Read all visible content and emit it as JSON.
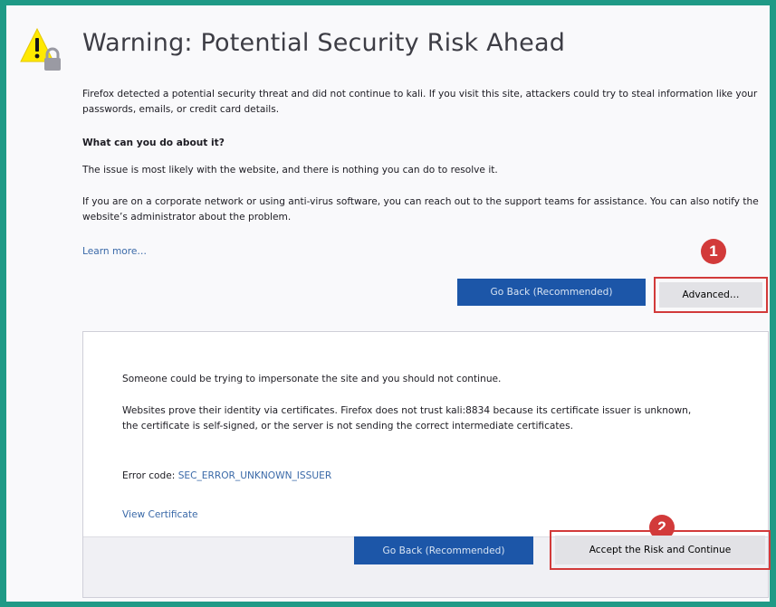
{
  "header": {
    "title": "Warning: Potential Security Risk Ahead",
    "icon": "warning-lock-icon"
  },
  "main": {
    "intro": "Firefox detected a potential security threat and did not continue to kali. If you visit this site, attackers could try to steal information like your passwords, emails, or credit card details.",
    "what_heading": "What can you do about it?",
    "issue_text": "The issue is most likely with the website, and there is nothing you can do to resolve it.",
    "corporate_text": "If you are on a corporate network or using anti-virus software, you can reach out to the support teams for assistance. You can also notify the website’s administrator about the problem.",
    "learn_more": "Learn more…",
    "go_back_label": "Go Back (Recommended)",
    "advanced_label": "Advanced…"
  },
  "advanced_panel": {
    "impersonate_text": "Someone could be trying to impersonate the site and you should not continue.",
    "cert_text": "Websites prove their identity via certificates. Firefox does not trust kali:8834 because its certificate issuer is unknown, the certificate is self-signed, or the server is not sending the correct intermediate certificates.",
    "error_code_label": "Error code: ",
    "error_code": "SEC_ERROR_UNKNOWN_ISSUER",
    "view_certificate": "View Certificate",
    "go_back_label": "Go Back (Recommended)",
    "accept_label": "Accept the Risk and Continue"
  },
  "annotations": {
    "step1": "1",
    "step2": "2"
  },
  "colors": {
    "frame_border": "#1f9a86",
    "primary_button": "#1c56a8",
    "highlight": "#d23a3a",
    "link": "#3a69a8"
  }
}
